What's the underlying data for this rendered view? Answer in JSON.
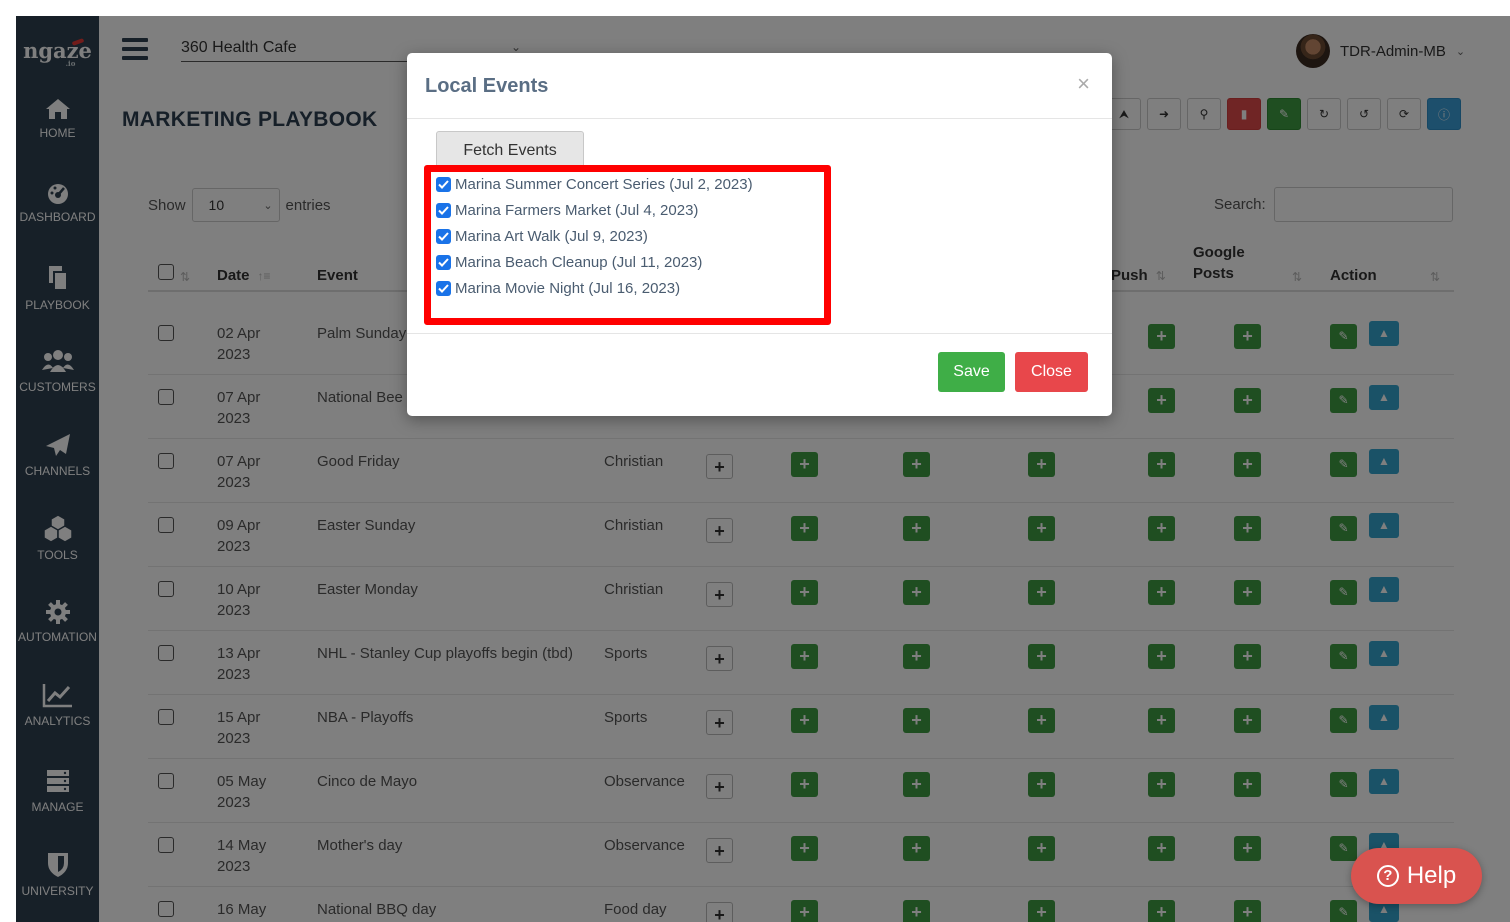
{
  "app": {
    "logo": "ngaze",
    "logo_suffix": ".io",
    "location": "360 Health Cafe",
    "user_name": "TDR-Admin-MB",
    "page_title": "MARKETING PLAYBOOK"
  },
  "sidebar": {
    "items": [
      {
        "label": "HOME",
        "icon": "home-icon"
      },
      {
        "label": "DASHBOARD",
        "icon": "dashboard-icon"
      },
      {
        "label": "PLAYBOOK",
        "icon": "playbook-icon"
      },
      {
        "label": "CUSTOMERS",
        "icon": "users-icon"
      },
      {
        "label": "CHANNELS",
        "icon": "paper-plane-icon"
      },
      {
        "label": "TOOLS",
        "icon": "cubes-icon"
      },
      {
        "label": "AUTOMATION",
        "icon": "gear-icon"
      },
      {
        "label": "ANALYTICS",
        "icon": "chart-line-icon"
      },
      {
        "label": "MANAGE",
        "icon": "server-icon"
      },
      {
        "label": "UNIVERSITY",
        "icon": "shield-icon"
      }
    ]
  },
  "table": {
    "show_label": "Show",
    "entries_value": "10",
    "entries_label": "entries",
    "search_label": "Search:",
    "columns": {
      "date": "Date",
      "event": "Event",
      "push": "Push",
      "google_posts": "Google Posts",
      "action": "Action"
    },
    "rows": [
      {
        "day": "02 Apr",
        "year": "2023",
        "event": "Palm Sunday",
        "category": ""
      },
      {
        "day": "07 Apr",
        "year": "2023",
        "event": "National Bee",
        "category": ""
      },
      {
        "day": "07 Apr",
        "year": "2023",
        "event": "Good Friday",
        "category": "Christian"
      },
      {
        "day": "09 Apr",
        "year": "2023",
        "event": "Easter Sunday",
        "category": "Christian"
      },
      {
        "day": "10 Apr",
        "year": "2023",
        "event": "Easter Monday",
        "category": "Christian"
      },
      {
        "day": "13 Apr",
        "year": "2023",
        "event": "NHL - Stanley Cup playoffs begin (tbd)",
        "category": "Sports"
      },
      {
        "day": "15 Apr",
        "year": "2023",
        "event": "NBA - Playoffs",
        "category": "Sports"
      },
      {
        "day": "05 May",
        "year": "2023",
        "event": "Cinco de Mayo",
        "category": "Observance"
      },
      {
        "day": "14 May",
        "year": "2023",
        "event": "Mother's day",
        "category": "Observance"
      },
      {
        "day": "16 May",
        "year": "2023",
        "event": "National BBQ day",
        "category": "Food day"
      }
    ]
  },
  "modal": {
    "title": "Local Events",
    "close_symbol": "×",
    "fetch_label": "Fetch Events",
    "events": [
      {
        "label": "Marina Summer Concert Series (Jul 2, 2023)",
        "checked": true
      },
      {
        "label": "Marina Farmers Market (Jul 4, 2023)",
        "checked": true
      },
      {
        "label": "Marina Art Walk (Jul 9, 2023)",
        "checked": true
      },
      {
        "label": "Marina Beach Cleanup (Jul 11, 2023)",
        "checked": true
      },
      {
        "label": "Marina Movie Night (Jul 16, 2023)",
        "checked": true
      }
    ],
    "save_label": "Save",
    "close_label": "Close",
    "highlight_color": "#ff0000"
  },
  "help": {
    "label": "Help"
  },
  "colors": {
    "sidebar": "#2f4050",
    "green": "#3f9c43",
    "red": "#e8474b",
    "blue": "#35a4cf"
  }
}
